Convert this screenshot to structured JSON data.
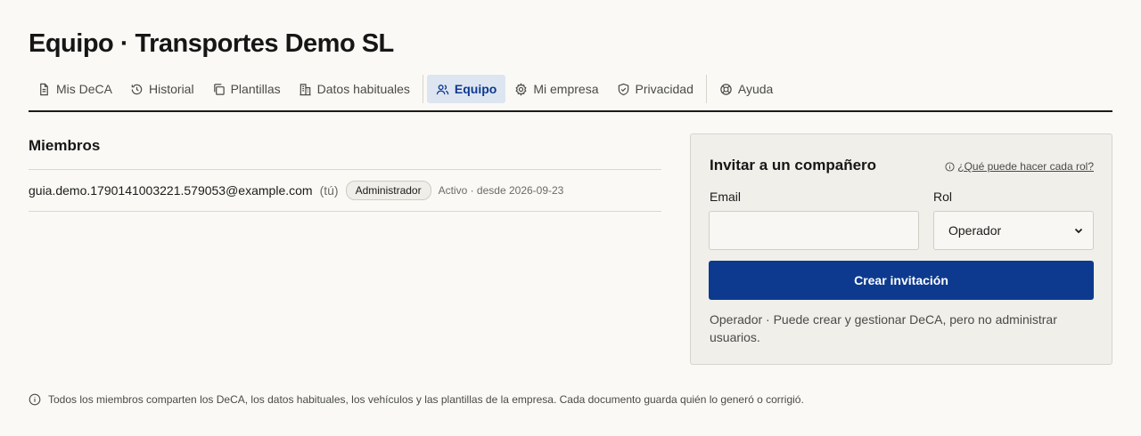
{
  "page": {
    "title": "Equipo · Transportes Demo SL"
  },
  "nav": {
    "items": [
      {
        "label": "Mis DeCA",
        "icon": "document-icon"
      },
      {
        "label": "Historial",
        "icon": "history-icon"
      },
      {
        "label": "Plantillas",
        "icon": "copy-icon"
      },
      {
        "label": "Datos habituales",
        "icon": "building-icon"
      },
      {
        "label": "Equipo",
        "icon": "users-icon",
        "active": true
      },
      {
        "label": "Mi empresa",
        "icon": "gear-icon"
      },
      {
        "label": "Privacidad",
        "icon": "shield-icon"
      },
      {
        "label": "Ayuda",
        "icon": "lifebuoy-icon"
      }
    ]
  },
  "members": {
    "title": "Miembros",
    "rows": [
      {
        "email": "guia.demo.1790141003221.579053@example.com",
        "you": "(tú)",
        "role": "Administrador",
        "status": "Activo · desde 2026-09-23"
      }
    ]
  },
  "invite": {
    "title": "Invitar a un compañero",
    "roles_help": "¿Qué puede hacer cada rol?",
    "email_label": "Email",
    "email_value": "",
    "role_label": "Rol",
    "role_selected": "Operador",
    "create_button": "Crear invitación",
    "role_description": "Operador · Puede crear y gestionar DeCA, pero no administrar usuarios."
  },
  "footer": {
    "note": "Todos los miembros comparten los DeCA, los datos habituales, los vehículos y las plantillas de la empresa. Cada documento guarda quién lo generó o corrigió."
  },
  "colors": {
    "accent": "#0d3a8e",
    "active_tab_bg": "#dde5f1",
    "background": "#faf9f5",
    "card_bg": "#f0efea"
  }
}
